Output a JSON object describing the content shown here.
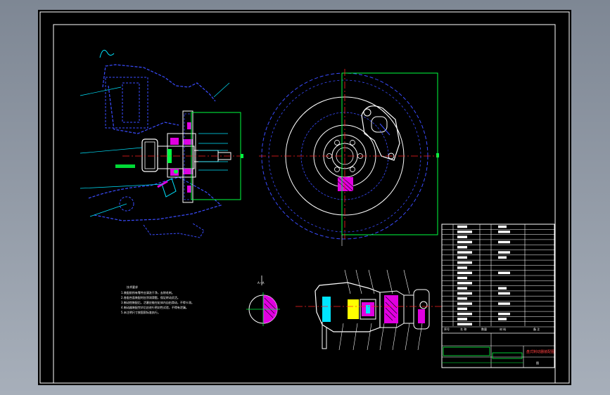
{
  "drawing": {
    "colors": {
      "background": "#000000",
      "frame": "#ffffff",
      "outline_blue": "#3a4cff",
      "cyan": "#00e5ff",
      "green": "#00ff40",
      "red": "#ff2020",
      "magenta": "#e000e0",
      "yellow": "#ffff00"
    },
    "section_label": "A—A",
    "tech_requirements": {
      "title": "技术要求",
      "lines": [
        "1.装配前所有零件应清洗干净，去除毛刺。",
        "2.各配合面装配时应涂润滑脂，保证转动灵活。",
        "3.制动钳装配后，活塞应能在缸体内自由滑动，不得卡滞。",
        "4.制动器装配完毕后应进行密封性试验，不得有泄漏。",
        "5.未注明尺寸按国家标准执行。"
      ]
    },
    "title_block": {
      "header_seq": "序号",
      "header_name": "名 称",
      "header_qty": "数量",
      "header_material": "材 料",
      "header_note": "备 注",
      "drawing_title": "盘式制动器装配图",
      "sheet_label": "图"
    }
  }
}
